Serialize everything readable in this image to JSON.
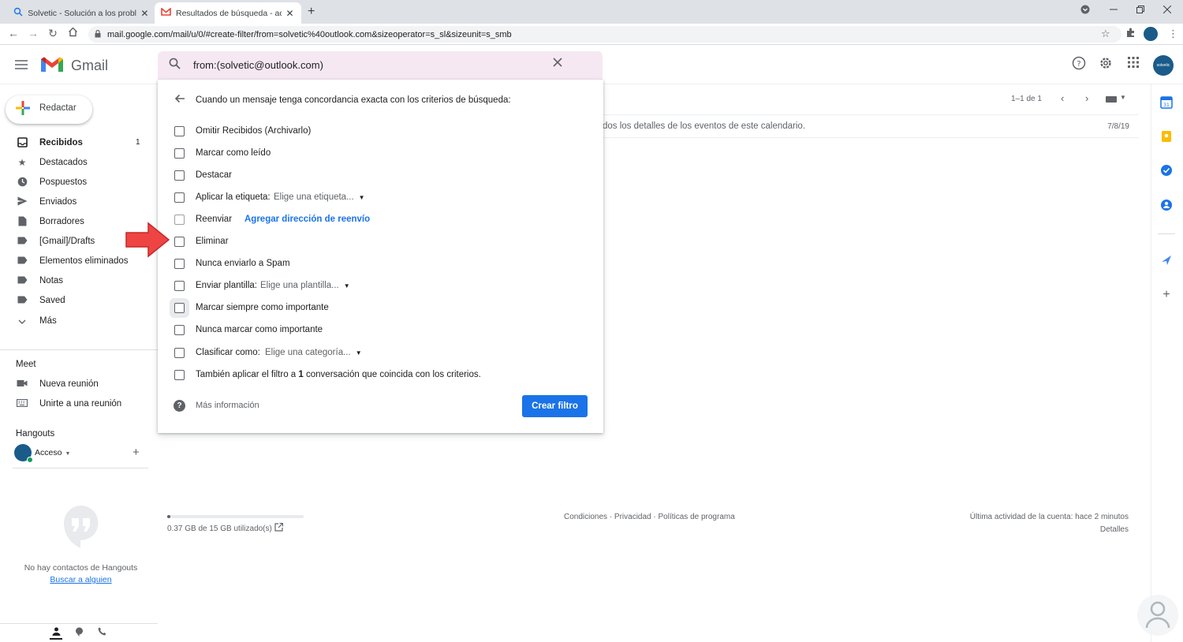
{
  "browser": {
    "tabs": [
      {
        "label": "Solvetic - Solución a los problem",
        "close": "✕"
      },
      {
        "label": "Resultados de búsqueda - acces",
        "close": "✕"
      }
    ],
    "new_tab": "+",
    "url": "mail.google.com/mail/u/0/#create-filter/from=solvetic%40outlook.com&sizeoperator=s_sl&sizeunit=s_smb"
  },
  "header": {
    "app_name": "Gmail",
    "search_value": "from:(solvetic@outlook.com)",
    "avatar_text": "solvetic"
  },
  "sidebar": {
    "compose_label": "Redactar",
    "items": [
      {
        "label": "Recibidos",
        "count": "1"
      },
      {
        "label": "Destacados"
      },
      {
        "label": "Pospuestos"
      },
      {
        "label": "Enviados"
      },
      {
        "label": "Borradores"
      },
      {
        "label": "[Gmail]/Drafts"
      },
      {
        "label": "Elementos eliminados"
      },
      {
        "label": "Notas"
      },
      {
        "label": "Saved"
      },
      {
        "label": "Más"
      }
    ],
    "meet_title": "Meet",
    "meet_items": [
      {
        "label": "Nueva reunión"
      },
      {
        "label": "Unirte a una reunión"
      }
    ],
    "hangouts_title": "Hangouts",
    "hangouts_user": "Acceso",
    "no_contacts": "No hay contactos de Hangouts",
    "find_someone": "Buscar a alguien"
  },
  "main": {
    "pager_text": "1–1 de 1",
    "email_snippet": "dos los detalles de los eventos de este calendario.",
    "email_date": "7/8/19"
  },
  "filter": {
    "title": "Cuando un mensaje tenga concordancia exacta con los criterios de búsqueda:",
    "options": [
      {
        "label": "Omitir Recibidos (Archivarlo)"
      },
      {
        "label": "Marcar como leído"
      },
      {
        "label": "Destacar"
      },
      {
        "label": "Aplicar la etiqueta:",
        "select": "Elige una etiqueta..."
      },
      {
        "label": "Reenviar",
        "link": "Agregar dirección de reenvío"
      },
      {
        "label": "Eliminar"
      },
      {
        "label": "Nunca enviarlo a Spam"
      },
      {
        "label": "Enviar plantilla:",
        "select": "Elige una plantilla..."
      },
      {
        "label": "Marcar siempre como importante"
      },
      {
        "label": "Nunca marcar como importante"
      },
      {
        "label": "Clasificar como:",
        "select": "Elige una categoría..."
      }
    ],
    "also_apply_pre": "También aplicar el filtro a ",
    "also_apply_count": "1",
    "also_apply_post": " conversación que coincida con los criterios.",
    "help_text": "Más información",
    "create_button": "Crear filtro"
  },
  "footer": {
    "storage_used_fraction": 0.025,
    "storage_text": "0.37 GB de 15 GB utilizado(s)",
    "links": "Condiciones · Privacidad · Políticas de programa",
    "last_activity": "Última actividad de la cuenta: hace 2 minutos",
    "details": "Detalles"
  },
  "colors": {
    "accent": "#1a73e8",
    "search_bg": "#f6e8f2",
    "annotation_arrow": "#ef4444"
  }
}
